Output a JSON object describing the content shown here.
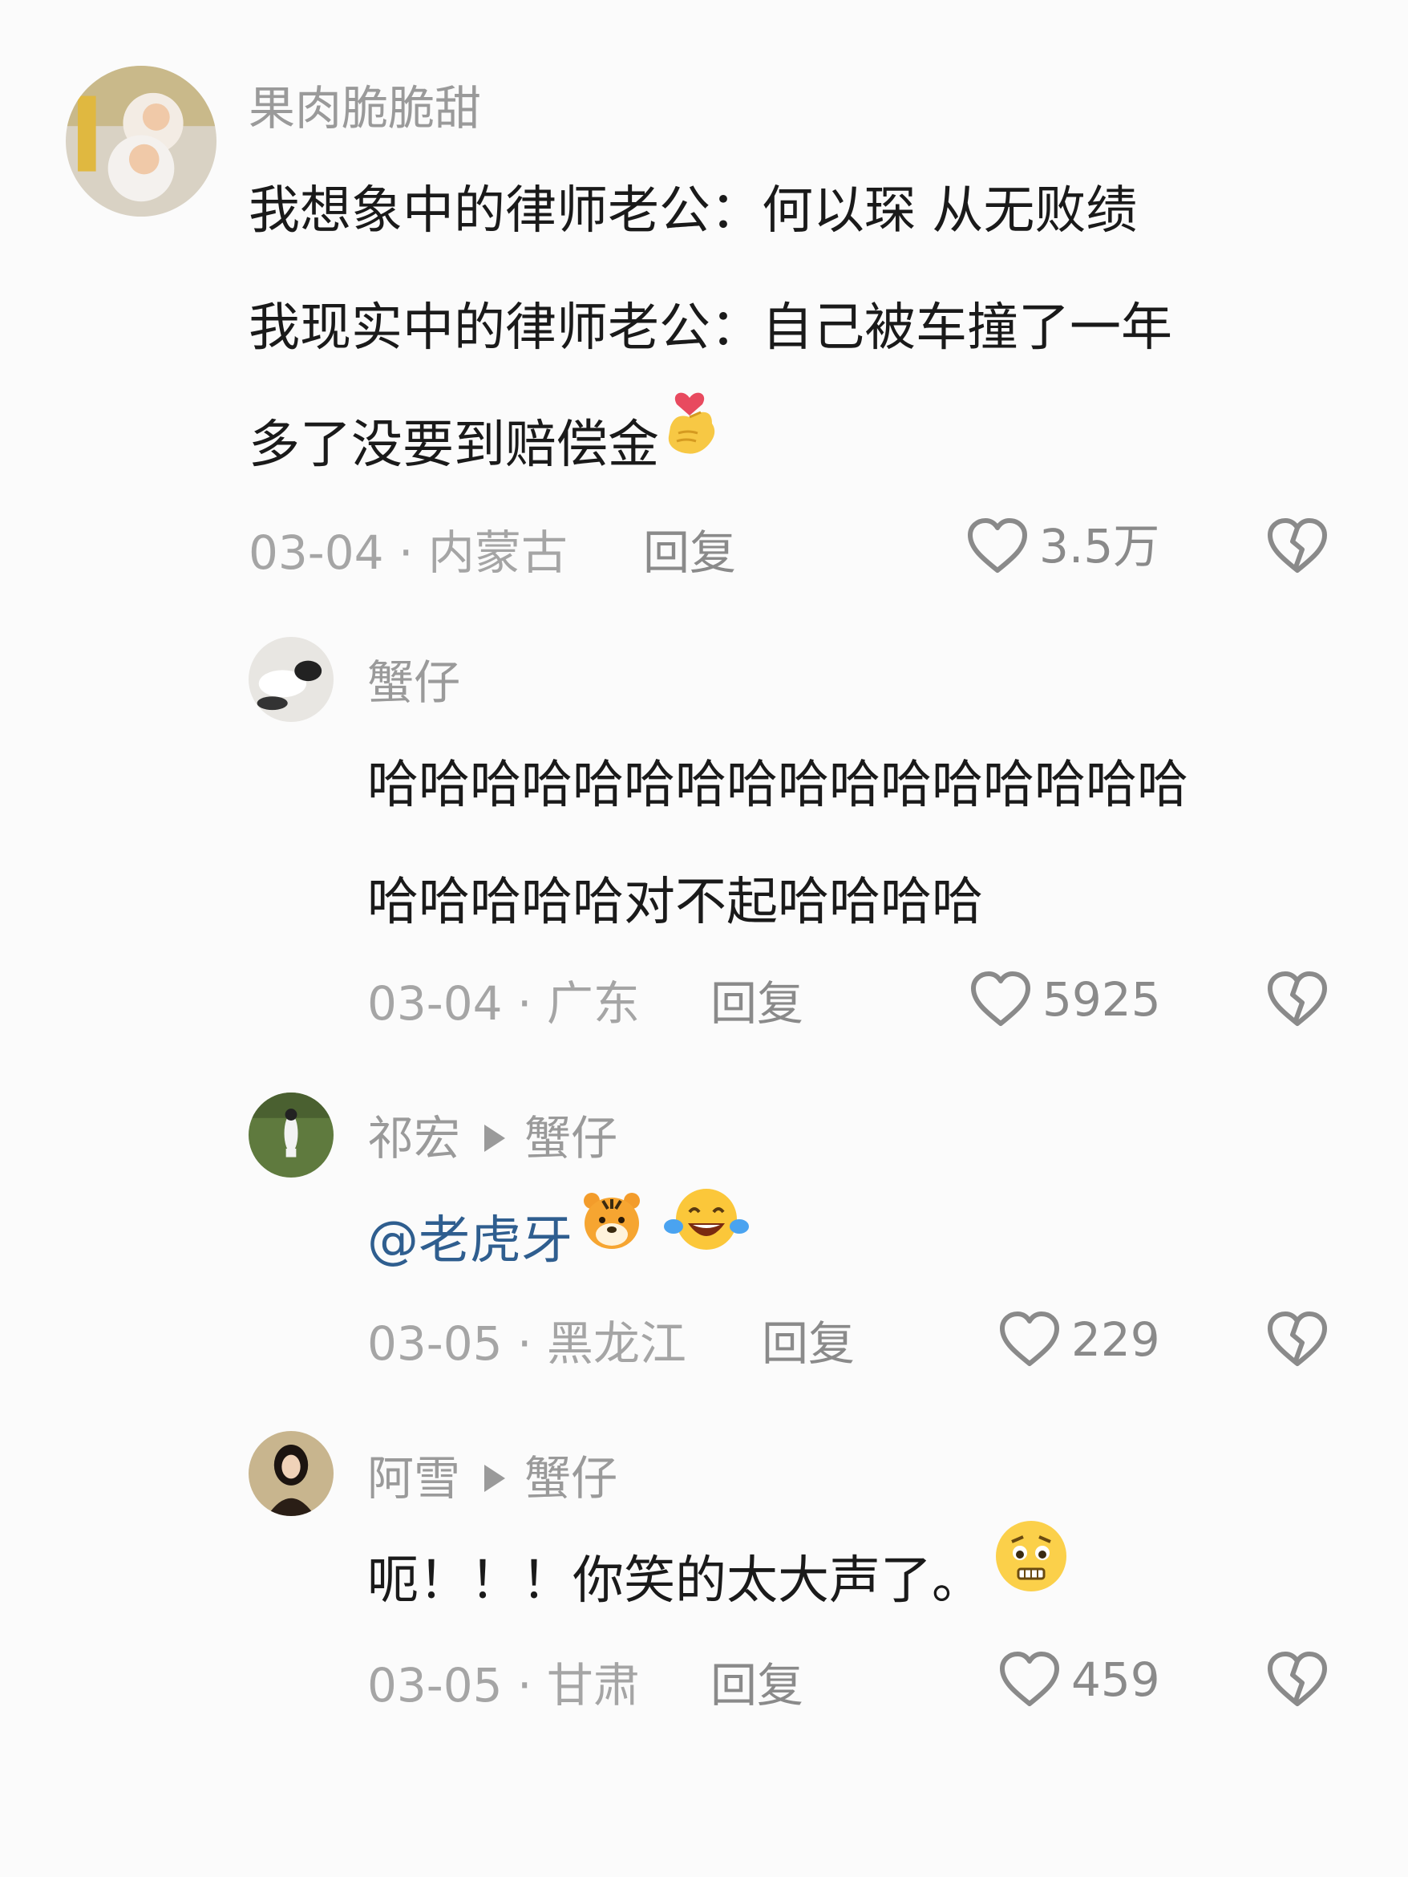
{
  "comments": [
    {
      "username": "果肉脆脆甜",
      "reply_to": "",
      "lines": [
        "我想象中的律师老公：何以琛 从无败绩",
        "我现实中的律师老公：自己被车撞了一年",
        "多了没要到赔偿金"
      ],
      "emoji_after": "finger-heart-emoji",
      "date": "03-04",
      "location": "内蒙古",
      "reply_label": "回复",
      "likes": "3.5万"
    },
    {
      "username": "蟹仔",
      "reply_to": "",
      "lines": [
        "哈哈哈哈哈哈哈哈哈哈哈哈哈哈哈哈",
        "哈哈哈哈哈对不起哈哈哈哈"
      ],
      "date": "03-04",
      "location": "广东",
      "reply_label": "回复",
      "likes": "5925"
    },
    {
      "username": "祁宏",
      "reply_to": "蟹仔",
      "mention": "@老虎牙",
      "date": "03-05",
      "location": "黑龙江",
      "reply_label": "回复",
      "likes": "229"
    },
    {
      "username": "阿雪",
      "reply_to": "蟹仔",
      "text": "呃！！！你笑的太大声了。",
      "date": "03-05",
      "location": "甘肃",
      "reply_label": "回复",
      "likes": "459"
    }
  ],
  "colors": {
    "background": "#fbfbfb",
    "username": "#9a9a9a",
    "meta": "#a5a5a5",
    "mention": "#2f5e8f",
    "text": "#1a1a1a"
  }
}
